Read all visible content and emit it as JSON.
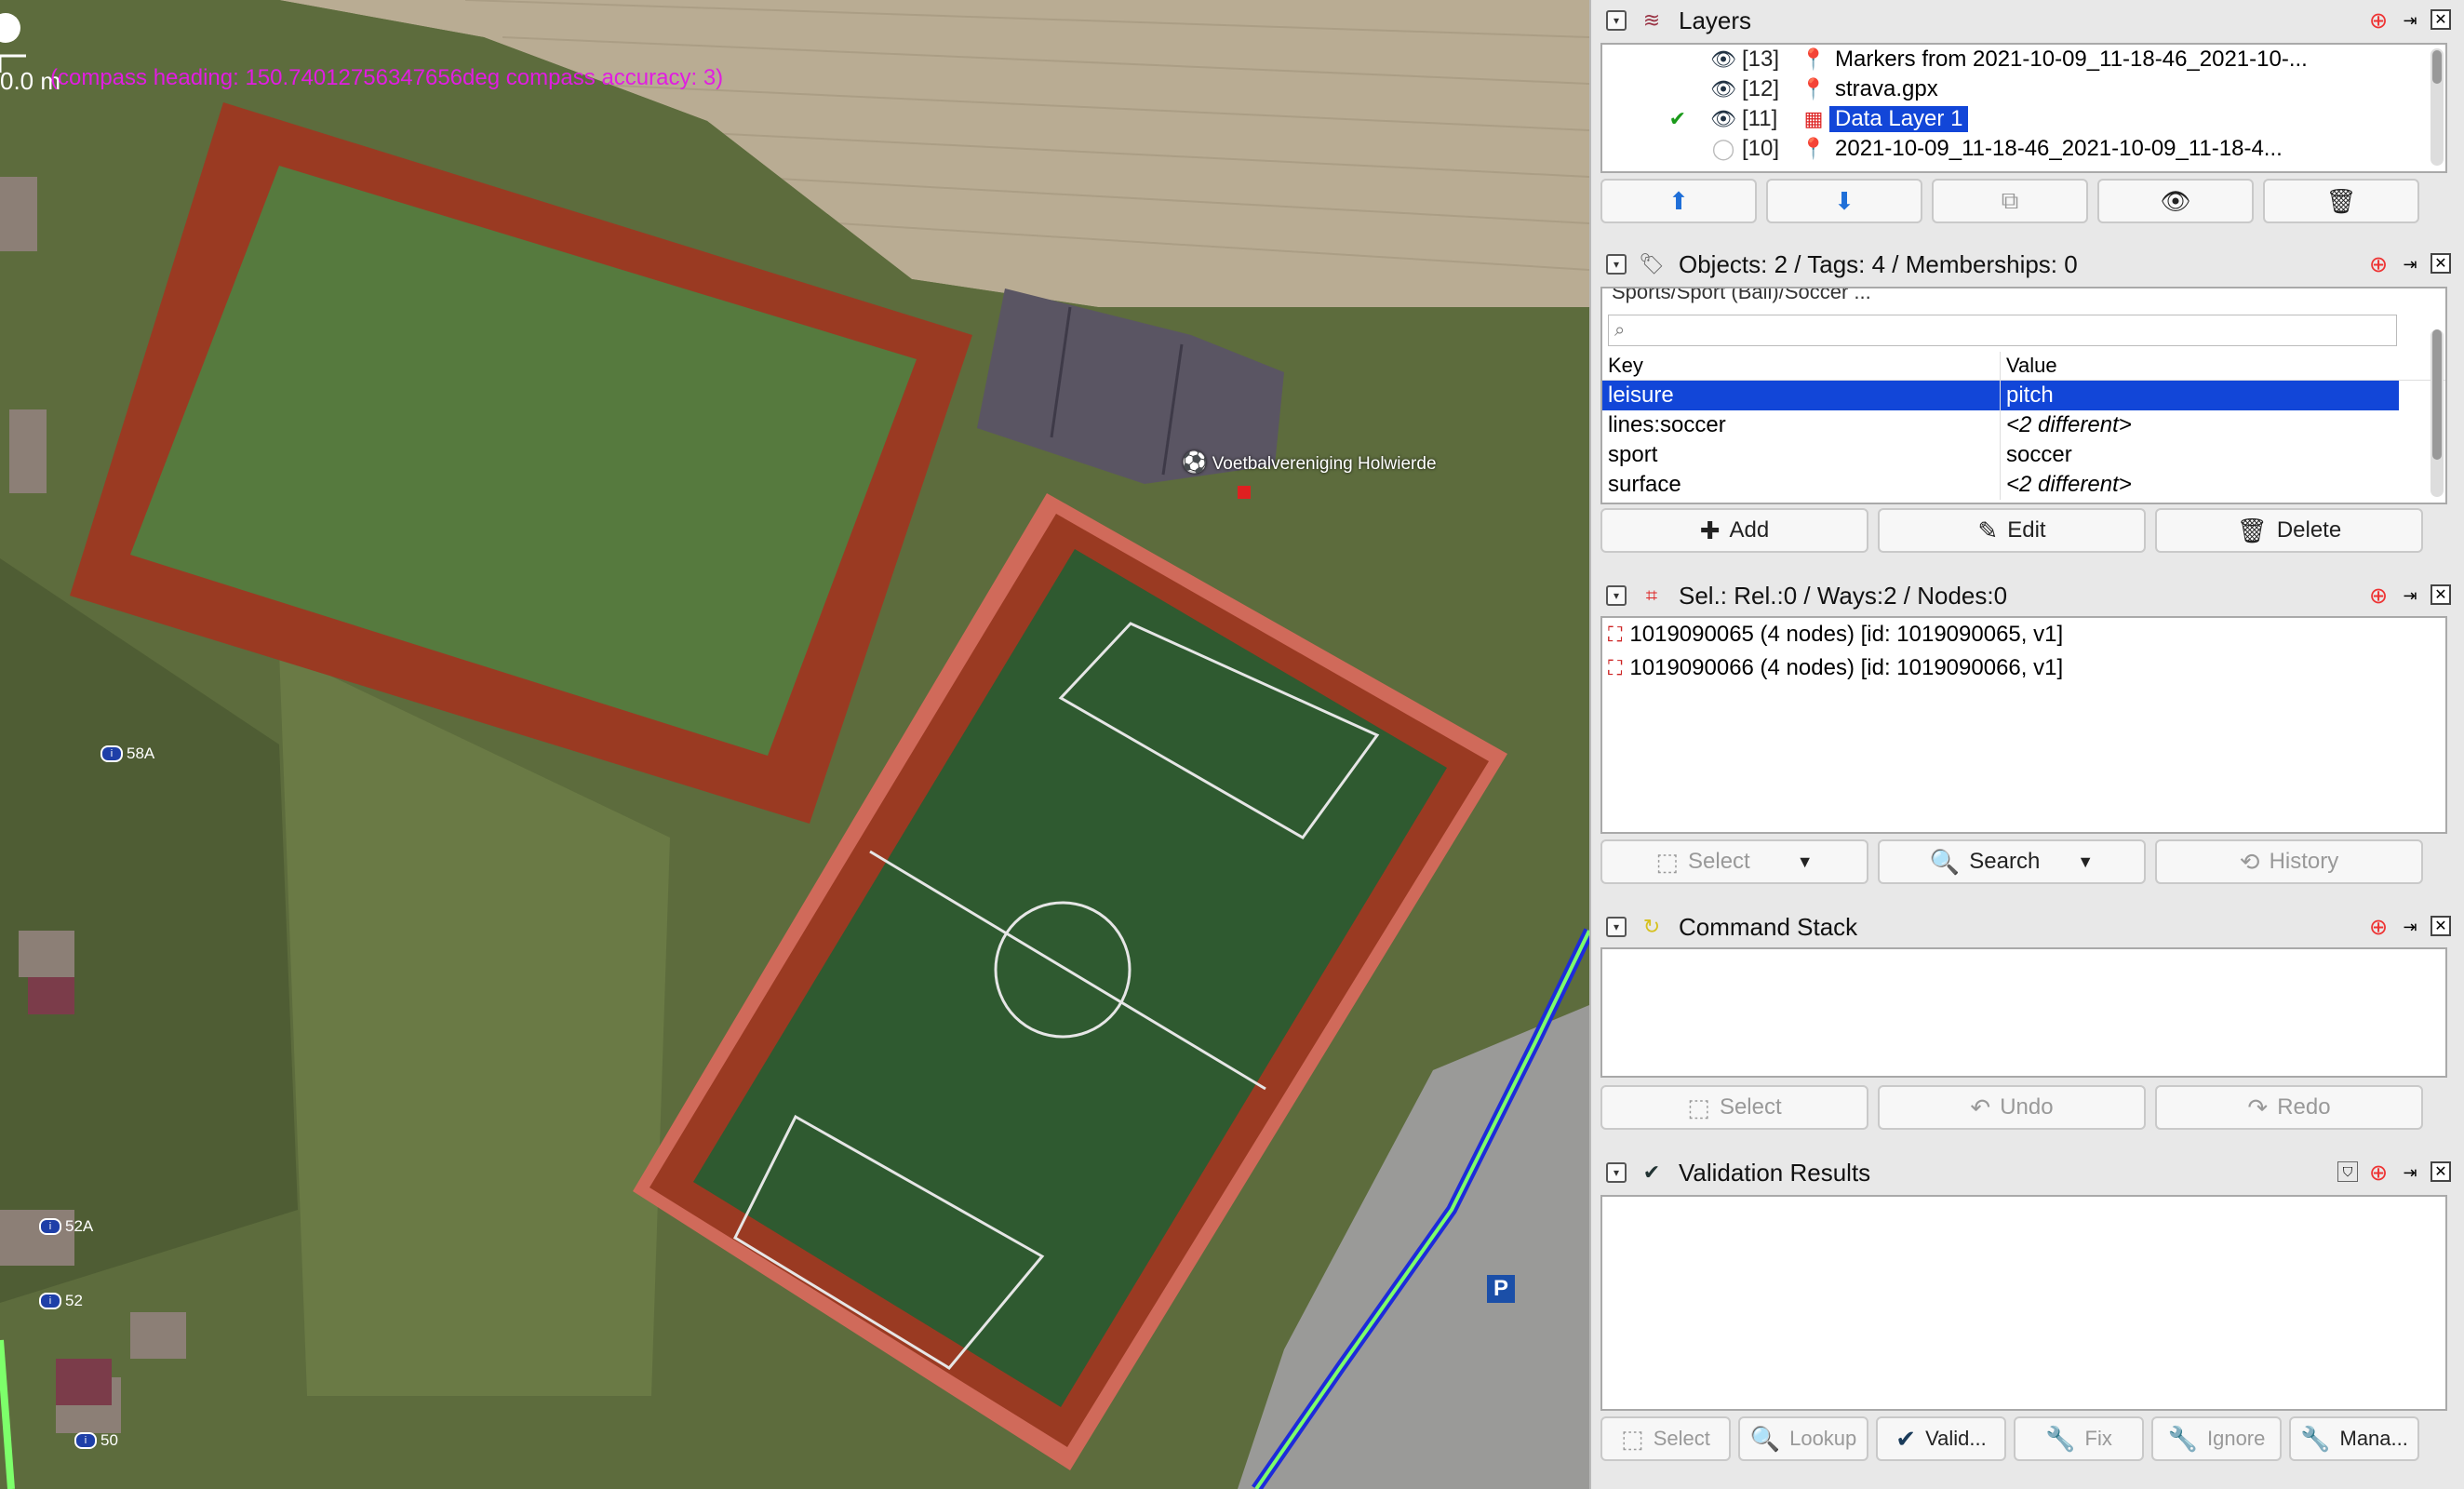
{
  "map": {
    "scale_label": "0.0 m",
    "compass_text": "(compass heading: 150.74012756347656deg   compass accuracy: 3)",
    "club_label": "Voetbalvereniging Holwierde",
    "house_numbers": [
      "58A",
      "52A",
      "52",
      "50"
    ],
    "parking_label": "P"
  },
  "layers": {
    "title": "Layers",
    "items": [
      {
        "index": "[13]",
        "name": "Markers from 2021-10-09_11-18-46_2021-10-...",
        "visible": true,
        "active": false,
        "selected": false,
        "icon": "marker-icon"
      },
      {
        "index": "[12]",
        "name": "strava.gpx",
        "visible": true,
        "active": false,
        "selected": false,
        "icon": "gpx-pin-icon"
      },
      {
        "index": "[11]",
        "name": "Data Layer 1",
        "visible": true,
        "active": true,
        "selected": true,
        "icon": "data-layer-icon"
      },
      {
        "index": "[10]",
        "name": "2021-10-09_11-18-46_2021-10-09_11-18-4...",
        "visible": false,
        "active": false,
        "selected": false,
        "icon": "gpx-pin-icon"
      }
    ],
    "buttons": [
      "move-up-icon",
      "move-down-icon",
      "merge-icon",
      "visibility-icon",
      "delete-icon"
    ]
  },
  "tags": {
    "title": "Objects: 2 / Tags: 4 / Memberships: 0",
    "preset_text": "Sports/Sport (Ball)/Soccer ...",
    "search_placeholder": "",
    "col_key": "Key",
    "col_value": "Value",
    "rows": [
      {
        "key": "leisure",
        "value": "pitch",
        "different": false
      },
      {
        "key": "lines:soccer",
        "value": "<2 different>",
        "different": true
      },
      {
        "key": "sport",
        "value": "soccer",
        "different": false
      },
      {
        "key": "surface",
        "value": "<2 different>",
        "different": true
      }
    ],
    "add_label": "Add",
    "edit_label": "Edit",
    "delete_label": "Delete"
  },
  "selection": {
    "title": "Sel.: Rel.:0 / Ways:2 / Nodes:0",
    "items": [
      "1019090065 (4 nodes) [id: 1019090065, v1]",
      "1019090066 (4 nodes) [id: 1019090066, v1]"
    ],
    "select_label": "Select",
    "search_label": "Search",
    "history_label": "History"
  },
  "commands": {
    "title": "Command Stack",
    "select_label": "Select",
    "undo_label": "Undo",
    "redo_label": "Redo"
  },
  "validation": {
    "title": "Validation Results",
    "select_label": "Select",
    "lookup_label": "Lookup",
    "validate_label": "Valid...",
    "fix_label": "Fix",
    "ignore_label": "Ignore",
    "manage_label": "Mana..."
  },
  "colors": {
    "selection_blue": "#1246d8",
    "compass_magenta": "#e11de1",
    "track_red": "#9a3a22",
    "pitch_green": "#2f5a30"
  }
}
